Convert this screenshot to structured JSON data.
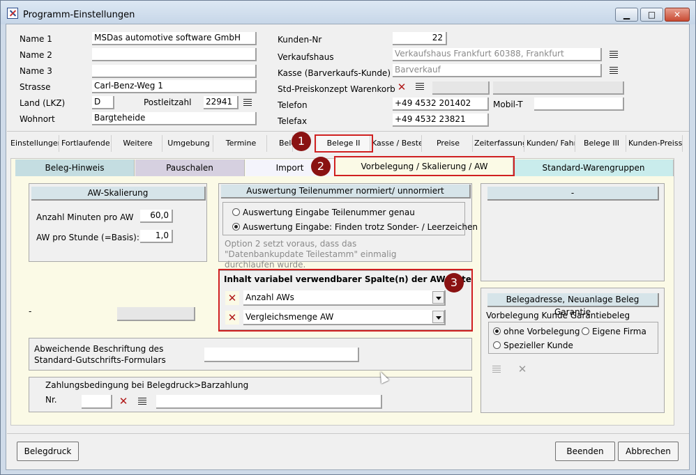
{
  "window": {
    "title": "Programm-Einstellungen",
    "minimize": "▁",
    "maximize": "□",
    "close": "✕"
  },
  "company": {
    "name1_label": "Name 1",
    "name1": "MSDas automotive software GmbH",
    "name2_label": "Name 2",
    "name2": "",
    "name3_label": "Name 3",
    "name3": "",
    "street_label": "Strasse",
    "street": "Carl-Benz-Weg 1",
    "country_label": "Land (LKZ)",
    "country": "D",
    "zip_label": "Postleitzahl",
    "zip": "22941",
    "city_label": "Wohnort",
    "city": "Bargteheide"
  },
  "customer": {
    "number_label": "Kunden-Nr",
    "number": "22",
    "salesoffice_label": "Verkaufshaus",
    "salesoffice": "Verkaufshaus Frankfurt 60388, Frankfurt",
    "cash_label": "Kasse (Barverkaufs-Kunde)",
    "cash": "Barverkauf",
    "pricing_label": "Std-Preiskonzept Warenkorb",
    "phone_label": "Telefon",
    "phone": "+49 4532 201402",
    "mobile_label": "Mobil-T",
    "mobile": "",
    "fax_label": "Telefax",
    "fax": "+49 4532 23821"
  },
  "tabs": [
    "Einstellungen",
    "Fortlaufende N",
    "Weitere",
    "Umgebung",
    "Termine",
    "Bele",
    "Belege II",
    "Kasse / Beste",
    "Preise",
    "Zeiterfassung",
    "Kunden/ Fahrz",
    "Belege III",
    "Kunden-Preissl"
  ],
  "subtabs": [
    "Beleg-Hinweis",
    "Pauschalen",
    "Import",
    "Vorbelegung / Skalierung / AW",
    "Standard-Warengruppen"
  ],
  "badges": [
    "1",
    "2",
    "3"
  ],
  "aw": {
    "title": "AW-Skalierung",
    "minutes_label": "Anzahl Minuten pro AW",
    "minutes": "60,0",
    "perhour_label": "AW pro Stunde (=Basis):",
    "perhour": "1,0"
  },
  "partnum": {
    "title": "Auswertung Teilenummer normiert/ unnormiert",
    "opt1": "Auswertung Eingabe Teilenummer genau",
    "opt2": "Auswertung Eingabe: Finden trotz Sonder- / Leerzeichen",
    "note": "Option 2 setzt voraus, dass das \"Datenbankupdate Teilestamm\" einmalig durchlaufen wurde."
  },
  "right_top": {
    "title": "-"
  },
  "awlist": {
    "title": "Inhalt variabel verwendbarer Spalte(n) der AW-Liste",
    "col1": "Anzahl AWs",
    "col2": "Vergleichsmenge AW"
  },
  "dash_label": "-",
  "credit": {
    "label1": "Abweichende Beschriftung des",
    "label2": "Standard-Gutschrifts-Formulars",
    "value": ""
  },
  "payment": {
    "title": "Zahlungsbedingung bei Belegdruck>Barzahlung",
    "nr_label": "Nr."
  },
  "guarantee": {
    "title": "Belegadresse, Neuanlage Beleg Garantie",
    "sub": "Vorbelegung Kunde Garantiebeleg",
    "opt1": "ohne Vorbelegung",
    "opt2": "Eigene Firma",
    "opt3": "Spezieller Kunde"
  },
  "footer": {
    "print": "Belegdruck",
    "finish": "Beenden",
    "cancel": "Abbrechen"
  },
  "colors": {
    "highlight": "#d02020",
    "badge": "#8a1212",
    "panel": "#fbfae6"
  }
}
